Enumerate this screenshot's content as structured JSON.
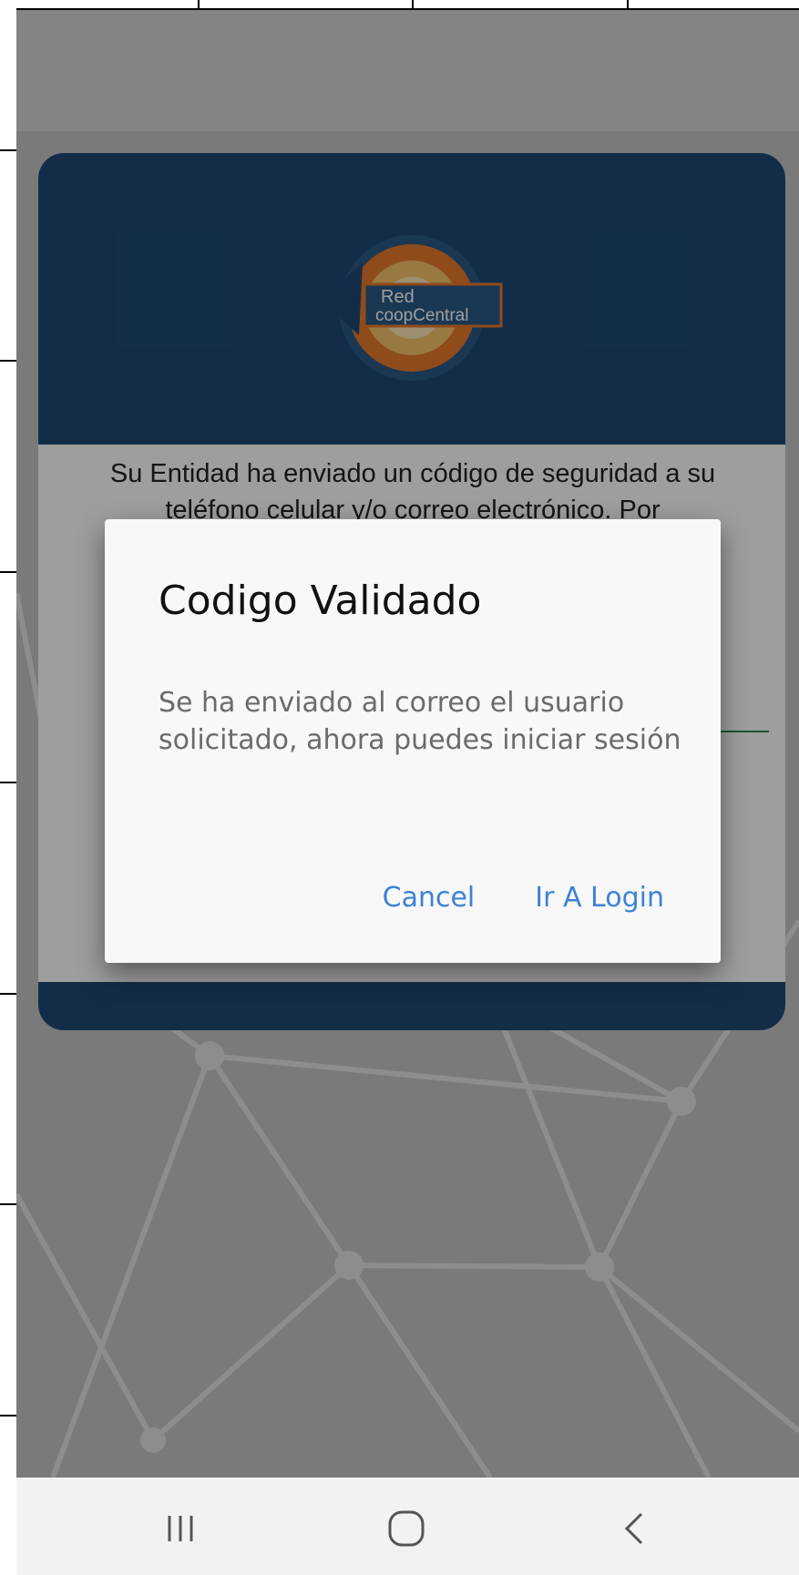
{
  "brand": {
    "logo_line1": "Red",
    "logo_line2": "coopCentral"
  },
  "card": {
    "instruction_text": "Su Entidad ha enviado un código de seguridad a su teléfono celular y/o correo electrónico. Por"
  },
  "dialog": {
    "title": "Codigo Validado",
    "message": "Se ha enviado al correo el usuario solicitado, ahora puedes iniciar sesión",
    "cancel_label": "Cancel",
    "confirm_label": "Ir A Login"
  },
  "colors": {
    "header_blue": "#1f4a74",
    "dialog_button": "#3d82d6",
    "accent_green": "#2e8b4e"
  },
  "navbar": {
    "recents_icon": "recents-icon",
    "home_icon": "home-icon",
    "back_icon": "back-icon"
  }
}
